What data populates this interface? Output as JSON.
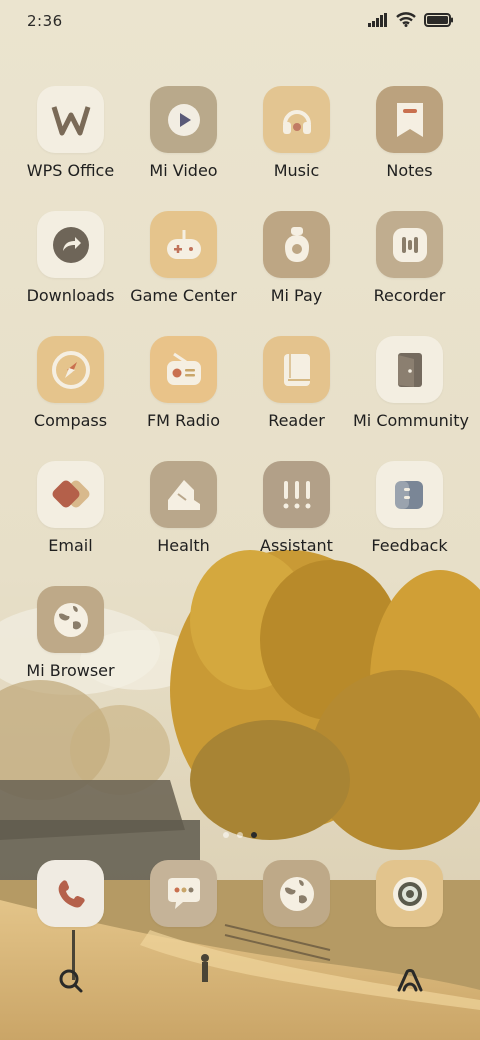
{
  "status_bar": {
    "time": "2:36"
  },
  "apps": [
    {
      "label": "WPS Office",
      "icon": "wps-office-icon",
      "bg": "#f3eee1"
    },
    {
      "label": "Mi Video",
      "icon": "mi-video-icon",
      "bg": "#b9a98b"
    },
    {
      "label": "Music",
      "icon": "music-icon",
      "bg": "#e3c591"
    },
    {
      "label": "Notes",
      "icon": "notes-icon",
      "bg": "#bba27e"
    },
    {
      "label": "Downloads",
      "icon": "downloads-icon",
      "bg": "#f3eee1"
    },
    {
      "label": "Game Center",
      "icon": "game-center-icon",
      "bg": "#e5c48c"
    },
    {
      "label": "Mi Pay",
      "icon": "mi-pay-icon",
      "bg": "#bda684"
    },
    {
      "label": "Recorder",
      "icon": "recorder-icon",
      "bg": "#c0ad8f"
    },
    {
      "label": "Compass",
      "icon": "compass-icon",
      "bg": "#e5c48c"
    },
    {
      "label": "FM Radio",
      "icon": "fm-radio-icon",
      "bg": "#e9c389"
    },
    {
      "label": "Reader",
      "icon": "reader-icon",
      "bg": "#e4c38d"
    },
    {
      "label": "Mi Community",
      "icon": "mi-community-icon",
      "bg": "#f3eee1"
    },
    {
      "label": "Email",
      "icon": "email-icon",
      "bg": "#f3eee1"
    },
    {
      "label": "Health",
      "icon": "health-icon",
      "bg": "#b9a78b"
    },
    {
      "label": "Assistant",
      "icon": "assistant-icon",
      "bg": "#b2a088"
    },
    {
      "label": "Feedback",
      "icon": "feedback-icon",
      "bg": "#f3eee1"
    },
    {
      "label": "Mi Browser",
      "icon": "mi-browser-icon",
      "bg": "#bea988"
    }
  ],
  "dock": [
    {
      "icon": "phone-icon",
      "bg": "#f0ebe2"
    },
    {
      "icon": "messaging-icon",
      "bg": "#c5b398"
    },
    {
      "icon": "browser-icon",
      "bg": "#bea988"
    },
    {
      "icon": "camera-icon",
      "bg": "#e2c48d"
    }
  ],
  "page_indicator": {
    "count": 3,
    "active": 2
  },
  "colors": {
    "label": "#1f1f1f",
    "accent": "#c89d5a"
  }
}
